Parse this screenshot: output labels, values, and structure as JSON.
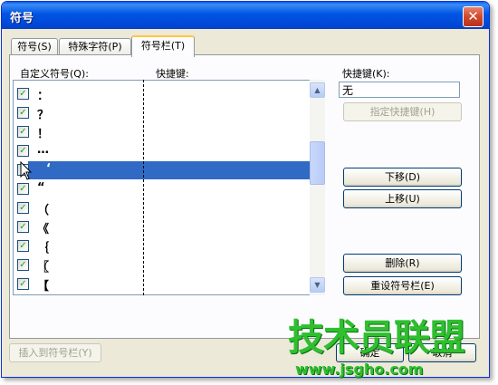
{
  "window": {
    "title": "符号",
    "close_symbol": "✕"
  },
  "tabs": [
    {
      "label": "符号(S)",
      "active": false
    },
    {
      "label": "特殊字符(P)",
      "active": false
    },
    {
      "label": "符号栏(T)",
      "active": true
    }
  ],
  "list": {
    "column_symbol": "自定义符号(Q):",
    "column_shortcut": "快捷键:",
    "check_mark": "✓",
    "rows": [
      {
        "symbol": "：",
        "checked": true,
        "selected": false
      },
      {
        "symbol": "？",
        "checked": true,
        "selected": false
      },
      {
        "symbol": "！",
        "checked": true,
        "selected": false
      },
      {
        "symbol": "…",
        "checked": true,
        "selected": false
      },
      {
        "symbol": "‘",
        "checked": false,
        "selected": true
      },
      {
        "symbol": "“",
        "checked": true,
        "selected": false
      },
      {
        "symbol": "（",
        "checked": true,
        "selected": false
      },
      {
        "symbol": "《",
        "checked": true,
        "selected": false
      },
      {
        "symbol": "｛",
        "checked": true,
        "selected": false
      },
      {
        "symbol": "〖",
        "checked": true,
        "selected": false
      },
      {
        "symbol": "【",
        "checked": true,
        "selected": false
      }
    ]
  },
  "shortcut_panel": {
    "label": "快捷键(K):",
    "value": "无",
    "assign_button": "指定快捷键(H)"
  },
  "buttons": {
    "move_down": "下移(D)",
    "move_up": "上移(U)",
    "delete": "删除(R)",
    "reset": "重设符号栏(E)",
    "insert_to_bar": "插入到符号栏(Y)",
    "ok": "确定",
    "cancel": "取消"
  },
  "watermark": {
    "text": "技术员联盟",
    "url": "www.jsgho.com"
  },
  "colors": {
    "titlebar": "#0054e3",
    "selection": "#316ac5",
    "watermark": "#2fbf2f"
  }
}
